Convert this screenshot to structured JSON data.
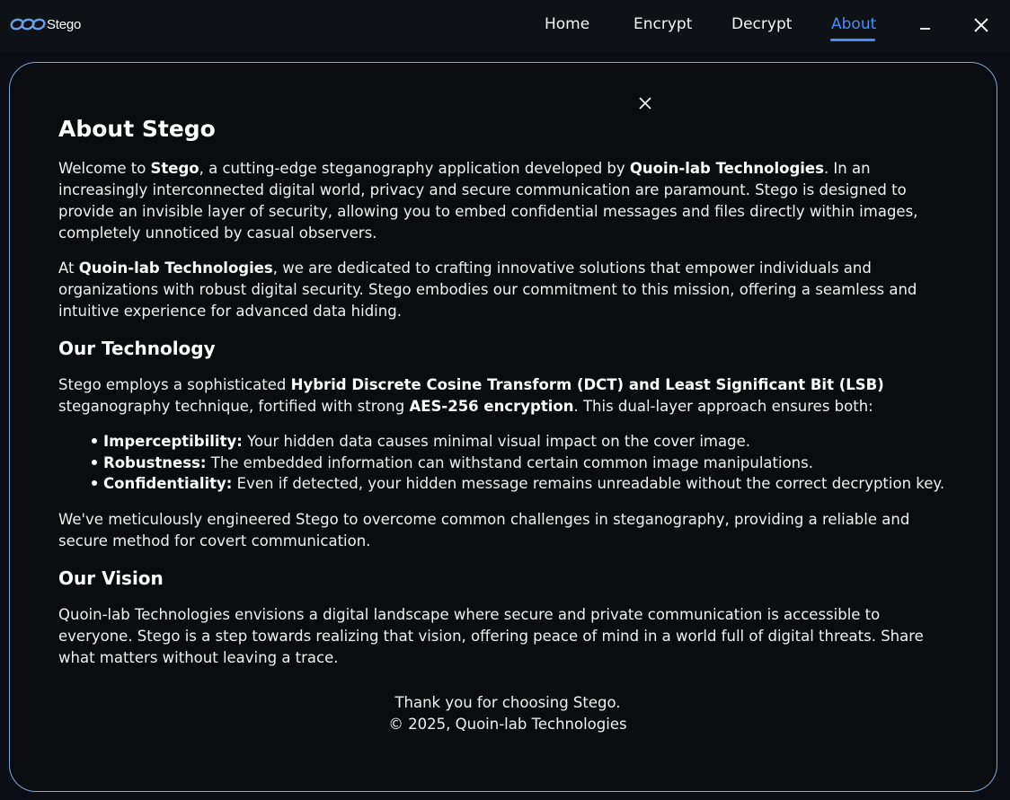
{
  "app": {
    "name": "Stego"
  },
  "nav": {
    "home": "Home",
    "encrypt": "Encrypt",
    "decrypt": "Decrypt",
    "about": "About"
  },
  "about": {
    "title": "About Stego",
    "intro": {
      "t1": "Welcome to ",
      "b1": "Stego",
      "t2": ", a cutting-edge steganography application developed by ",
      "b2": "Quoin-lab Technologies",
      "t3": ". In an increasingly interconnected digital world, privacy and secure communication are paramount. Stego is designed to provide an invisible layer of security, allowing you to embed confidential messages and files directly within images, completely unnoticed by casual observers."
    },
    "mission": {
      "t1": "At ",
      "b1": "Quoin-lab Technologies",
      "t2": ", we are dedicated to crafting innovative solutions that empower individuals and organizations with robust digital security. Stego embodies our commitment to this mission, offering a seamless and intuitive experience for advanced data hiding."
    },
    "tech_heading": "Our Technology",
    "tech": {
      "t1": "Stego employs a sophisticated ",
      "b1": "Hybrid Discrete Cosine Transform (DCT) and Least Significant Bit (LSB)",
      "t2": " steganography technique, fortified with strong ",
      "b2": "AES-256 encryption",
      "t3": ". This dual-layer approach ensures both:"
    },
    "bullets": [
      {
        "label": "Imperceptibility:",
        "text": " Your hidden data causes minimal visual impact on the cover image."
      },
      {
        "label": "Robustness:",
        "text": " The embedded information can withstand certain common image manipulations."
      },
      {
        "label": "Confidentiality:",
        "text": " Even if detected, your hidden message remains unreadable without the correct decryption key."
      }
    ],
    "engineering": "We've meticulously engineered Stego to overcome common challenges in steganography, providing a reliable and secure method for covert communication.",
    "vision_heading": "Our Vision",
    "vision": "Quoin-lab Technologies envisions a digital landscape where secure and private communication is accessible to everyone. Stego is a step towards realizing that vision, offering peace of mind in a world full of digital threats. Share what matters without leaving a trace.",
    "thanks": "Thank you for choosing Stego.",
    "copyright": "© 2025, Quoin-lab Technologies"
  },
  "colors": {
    "accent": "#4a8cf7",
    "panel_border": "#7fa7d4",
    "background": "#0a0d13"
  },
  "icons": {
    "logo": "infinity-chain-logo-icon",
    "minimize": "minimize-icon",
    "close": "close-icon"
  }
}
